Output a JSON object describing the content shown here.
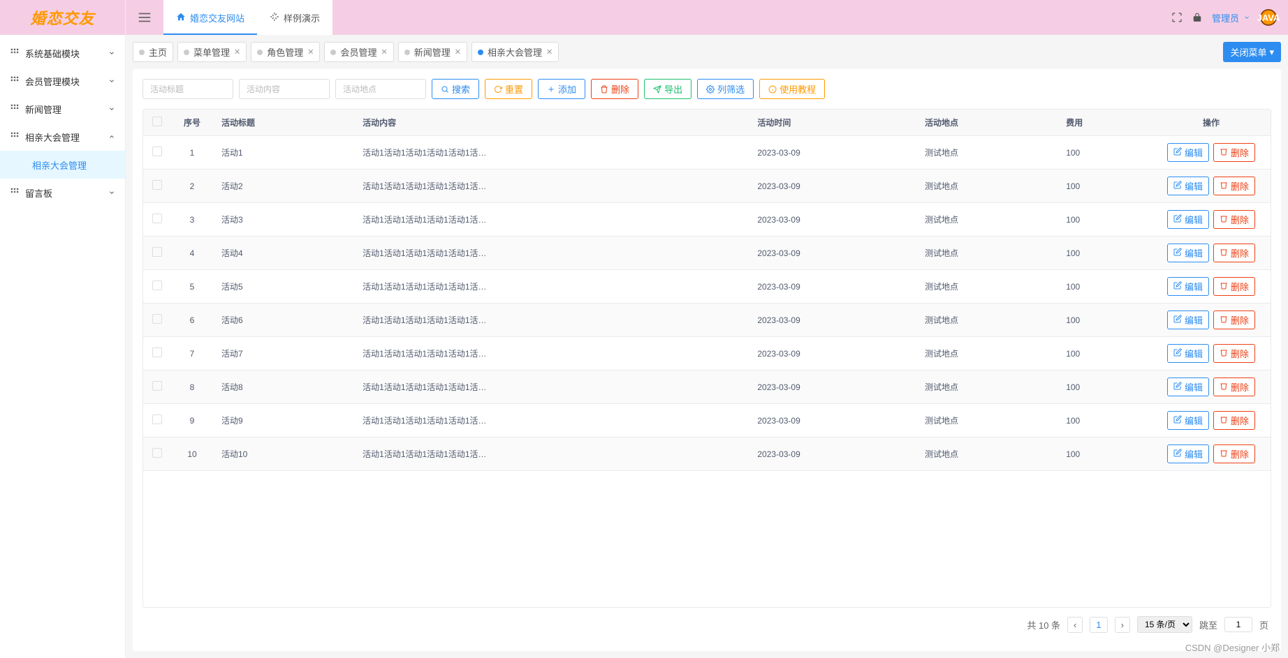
{
  "logo": "婚恋交友",
  "sidebar": [
    {
      "label": "系统基础模块",
      "icon": "grid",
      "expanded": false
    },
    {
      "label": "会员管理模块",
      "icon": "grid",
      "expanded": false
    },
    {
      "label": "新闻管理",
      "icon": "grid",
      "expanded": false
    },
    {
      "label": "相亲大会管理",
      "icon": "grid",
      "expanded": true,
      "children": [
        {
          "label": "相亲大会管理",
          "icon": "gear",
          "active": true
        }
      ]
    },
    {
      "label": "留言板",
      "icon": "grid",
      "expanded": false
    }
  ],
  "top_tabs": [
    {
      "label": "婚恋交友网站",
      "icon": "home",
      "active": true
    },
    {
      "label": "样例演示",
      "icon": "spark",
      "active": false
    }
  ],
  "top_right": {
    "user": "管理员",
    "avatar_text": "JAVA"
  },
  "chip_tabs": [
    {
      "label": "主页",
      "closable": false,
      "active": false
    },
    {
      "label": "菜单管理",
      "closable": true,
      "active": false
    },
    {
      "label": "角色管理",
      "closable": true,
      "active": false
    },
    {
      "label": "会员管理",
      "closable": true,
      "active": false
    },
    {
      "label": "新闻管理",
      "closable": true,
      "active": false
    },
    {
      "label": "相亲大会管理",
      "closable": true,
      "active": true
    }
  ],
  "close_menu_label": "关闭菜单",
  "filters": {
    "title_ph": "活动标题",
    "content_ph": "活动内容",
    "place_ph": "活动地点"
  },
  "toolbar_buttons": {
    "search": "搜索",
    "reset": "重置",
    "add": "添加",
    "delete": "删除",
    "export": "导出",
    "column": "列筛选",
    "help": "使用教程"
  },
  "columns": [
    "",
    "序号",
    "活动标题",
    "活动内容",
    "活动时间",
    "活动地点",
    "费用",
    "操作"
  ],
  "rows": [
    {
      "idx": "1",
      "title": "活动1",
      "content": "活动1活动1活动1活动1活动1活…",
      "time": "2023-03-09",
      "place": "测试地点",
      "fee": "100"
    },
    {
      "idx": "2",
      "title": "活动2",
      "content": "活动1活动1活动1活动1活动1活…",
      "time": "2023-03-09",
      "place": "测试地点",
      "fee": "100"
    },
    {
      "idx": "3",
      "title": "活动3",
      "content": "活动1活动1活动1活动1活动1活…",
      "time": "2023-03-09",
      "place": "测试地点",
      "fee": "100"
    },
    {
      "idx": "4",
      "title": "活动4",
      "content": "活动1活动1活动1活动1活动1活…",
      "time": "2023-03-09",
      "place": "测试地点",
      "fee": "100"
    },
    {
      "idx": "5",
      "title": "活动5",
      "content": "活动1活动1活动1活动1活动1活…",
      "time": "2023-03-09",
      "place": "测试地点",
      "fee": "100"
    },
    {
      "idx": "6",
      "title": "活动6",
      "content": "活动1活动1活动1活动1活动1活…",
      "time": "2023-03-09",
      "place": "测试地点",
      "fee": "100"
    },
    {
      "idx": "7",
      "title": "活动7",
      "content": "活动1活动1活动1活动1活动1活…",
      "time": "2023-03-09",
      "place": "测试地点",
      "fee": "100"
    },
    {
      "idx": "8",
      "title": "活动8",
      "content": "活动1活动1活动1活动1活动1活…",
      "time": "2023-03-09",
      "place": "测试地点",
      "fee": "100"
    },
    {
      "idx": "9",
      "title": "活动9",
      "content": "活动1活动1活动1活动1活动1活…",
      "time": "2023-03-09",
      "place": "测试地点",
      "fee": "100"
    },
    {
      "idx": "10",
      "title": "活动10",
      "content": "活动1活动1活动1活动1活动1活…",
      "time": "2023-03-09",
      "place": "测试地点",
      "fee": "100"
    }
  ],
  "row_ops": {
    "edit": "编辑",
    "delete": "删除"
  },
  "pager": {
    "total_text": "共 10 条",
    "page": "1",
    "size": "15 条/页",
    "jump_label": "跳至",
    "jump_val": "1",
    "jump_suffix": "页"
  },
  "watermark": "CSDN @Designer 小郑"
}
